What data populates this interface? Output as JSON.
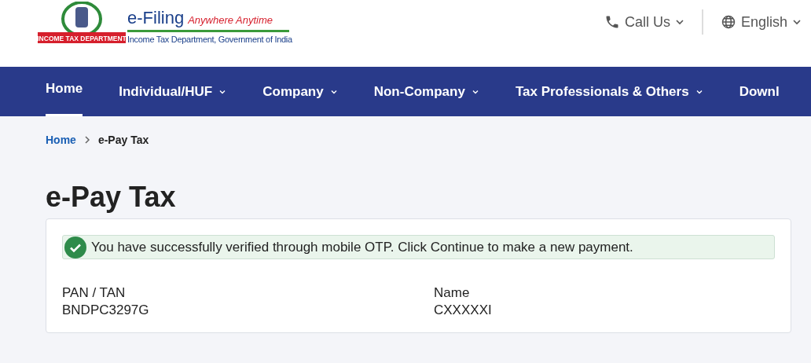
{
  "header": {
    "logo": {
      "ribbon": "INCOME TAX DEPARTMENT",
      "title": "e-Filing",
      "tagline": "Anywhere Anytime",
      "subtitle": "Income Tax Department, Government of India"
    },
    "call": {
      "label": "Call Us"
    },
    "language": {
      "label": "English"
    }
  },
  "nav": [
    {
      "label": "Home",
      "selected": true,
      "has_menu": false
    },
    {
      "label": "Individual/HUF",
      "selected": false,
      "has_menu": true
    },
    {
      "label": "Company",
      "selected": false,
      "has_menu": true
    },
    {
      "label": "Non-Company",
      "selected": false,
      "has_menu": true
    },
    {
      "label": "Tax Professionals & Others",
      "selected": false,
      "has_menu": true
    },
    {
      "label": "Downl",
      "selected": false,
      "has_menu": false
    }
  ],
  "breadcrumb": [
    {
      "label": "Home",
      "kind": "link"
    },
    {
      "label": "e-Pay Tax",
      "kind": "current"
    }
  ],
  "page_title": "e-Pay Tax",
  "alert": {
    "kind": "success",
    "message": "You have successfully verified through mobile OTP. Click Continue to make a new payment."
  },
  "fields": [
    {
      "label": "PAN / TAN",
      "value": "BNDPC3297G"
    },
    {
      "label": "Name",
      "value": "CXXXXXI"
    }
  ]
}
